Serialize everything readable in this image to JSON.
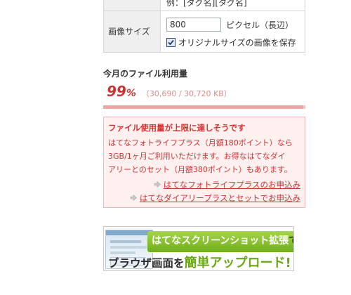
{
  "settings": {
    "tags_value": "例：[タグ名][タグ名]",
    "image_size_label": "画像サイズ",
    "image_size_value": "800",
    "image_size_unit": "ピクセル（長辺）",
    "keep_original_label": "オリジナルサイズの画像を保存",
    "keep_original_checked": true
  },
  "usage": {
    "title": "今月のファイル利用量",
    "percent_number": "99",
    "percent_sign": "%",
    "detail": "（30,690 / 30,720 KB）",
    "fill_fraction": 0.99,
    "bar_fill_color": "#f0a5a5",
    "bar_track_color": "#f5c6c6"
  },
  "warning": {
    "title": "ファイル使用量が上限に達しそうです",
    "line1": "はてなフォトライフプラス（月額180ポイント）なら",
    "line2": "3GB/1ヶ月ご利用いただけます。お得なはてなダイ",
    "line3": "アリーとのセット（月額380ポイント）もあります。",
    "link1": "はてなフォトライフプラスのお申込み",
    "link2": "はてなダイアリープラスとセットでお申込み",
    "accent_color": "#cc3333"
  },
  "banner": {
    "line1_main": "はてなスクリーンショット拡張",
    "line1_tail": "で",
    "line2_a": "ブラウザ画面",
    "line2_b": "を",
    "line2_c": "簡単アップロード!"
  }
}
